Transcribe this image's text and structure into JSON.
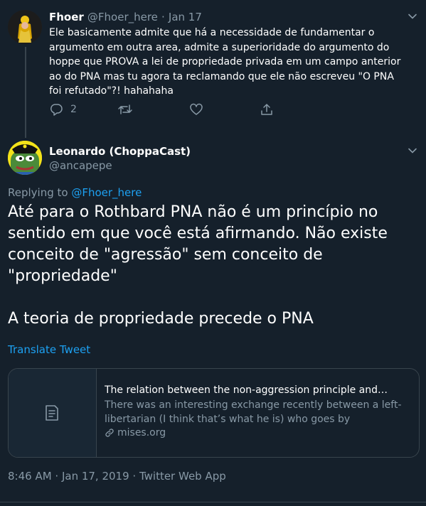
{
  "parent_tweet": {
    "name": "Fhoer",
    "handle": "@Fhoer_here",
    "separator": "·",
    "date": "Jan 17",
    "text": "Ele basicamente admite que há a necessidade de fundamentar o argumento em outra area, admite a superioridade do argumento do hoppe que PROVA a lei de propriedade privada em um campo anterior ao do PNA mas tu agora ta reclamando que ele não escreveu \"O PNA foi refutado\"?! hahahaha",
    "reply_count": "2",
    "retweet_count": "",
    "like_count": ""
  },
  "main_tweet": {
    "name": "Leonardo (ChoppaCast)",
    "handle": "@ancapepe",
    "replying_prefix": "Replying to ",
    "replying_to": "@Fhoer_here",
    "text_line1": "Até para o Rothbard PNA não é um princípio no sentido em que você está afirmando. Não existe conceito de \"agressão\" sem conceito de \"propriedade\"",
    "text_line2": "A teoria de propriedade precede o PNA",
    "translate_label": "Translate Tweet",
    "card": {
      "title": "The relation between the non-aggression principle and…",
      "description": "There was an interesting exchange recently between a left-libertarian (I think that’s what he is) who goes by",
      "domain": "mises.org"
    },
    "meta": "8:46 AM · Jan 17, 2019 · Twitter Web App"
  },
  "colors": {
    "background": "#15202b",
    "secondary_text": "#8899a6",
    "link": "#1da1f2",
    "border": "#38444d"
  }
}
